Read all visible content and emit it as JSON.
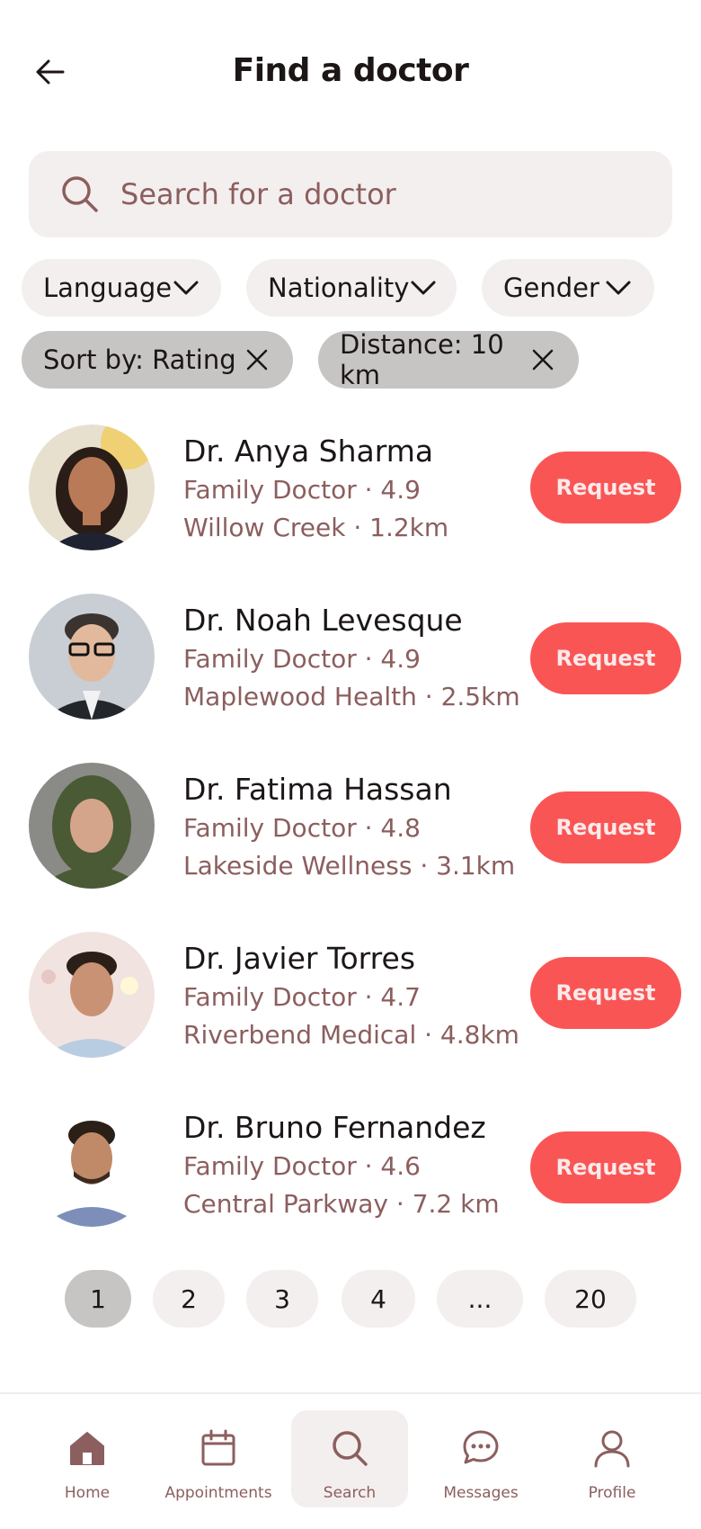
{
  "header": {
    "title": "Find a doctor"
  },
  "search": {
    "placeholder": "Search for a doctor"
  },
  "filters": [
    {
      "label": "Language"
    },
    {
      "label": "Nationality"
    },
    {
      "label": "Gender"
    }
  ],
  "active_filters": [
    {
      "label": "Sort by: Rating"
    },
    {
      "label": "Distance: 10 km"
    }
  ],
  "doctors": [
    {
      "name": "Dr. Anya Sharma",
      "specialty_rating": "Family Doctor · 4.9",
      "location_distance": "Willow Creek · 1.2km",
      "action": "Request"
    },
    {
      "name": "Dr. Noah Levesque",
      "specialty_rating": "Family Doctor · 4.9",
      "location_distance": "Maplewood Health · 2.5km",
      "action": "Request"
    },
    {
      "name": "Dr. Fatima Hassan",
      "specialty_rating": "Family Doctor · 4.8",
      "location_distance": "Lakeside Wellness · 3.1km",
      "action": "Request"
    },
    {
      "name": "Dr. Javier Torres",
      "specialty_rating": "Family Doctor · 4.7",
      "location_distance": "Riverbend Medical · 4.8km",
      "action": "Request"
    },
    {
      "name": "Dr. Bruno Fernandez",
      "specialty_rating": "Family Doctor · 4.6",
      "location_distance": "Central Parkway · 7.2 km",
      "action": "Request"
    }
  ],
  "pagination": {
    "pages": [
      "1",
      "2",
      "3",
      "4",
      "...",
      "20"
    ],
    "current": "1"
  },
  "nav": [
    {
      "label": "Home",
      "icon": "home-icon"
    },
    {
      "label": "Appointments",
      "icon": "calendar-icon"
    },
    {
      "label": "Search",
      "icon": "search-icon",
      "active": true
    },
    {
      "label": "Messages",
      "icon": "chat-bubble-icon"
    },
    {
      "label": "Profile",
      "icon": "user-icon"
    }
  ],
  "colors": {
    "accent": "#fa5555",
    "muted_text": "#8c5e5e",
    "chip_bg": "#f3efee",
    "active_chip_bg": "#c7c5c4"
  }
}
